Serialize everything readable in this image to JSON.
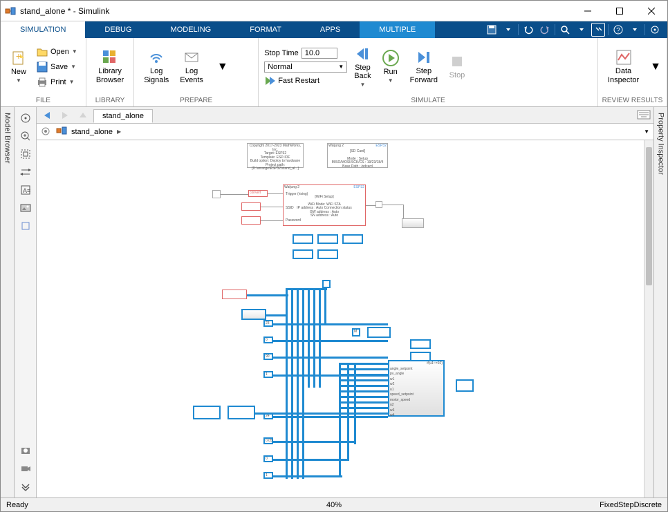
{
  "title": "stand_alone * - Simulink",
  "tabs": [
    "SIMULATION",
    "DEBUG",
    "MODELING",
    "FORMAT",
    "APPS",
    "MULTIPLE"
  ],
  "ribbon": {
    "file": {
      "new": "New",
      "open": "Open",
      "save": "Save",
      "print": "Print",
      "group": "FILE"
    },
    "library": {
      "browser": "Library\nBrowser",
      "group": "LIBRARY"
    },
    "prepare": {
      "log_signals": "Log\nSignals",
      "log_events": "Log\nEvents",
      "group": "PREPARE"
    },
    "simulate": {
      "stop_time_label": "Stop Time",
      "stop_time_value": "10.0",
      "mode": "Normal",
      "fast_restart": "Fast Restart",
      "step_back": "Step\nBack",
      "run": "Run",
      "step_forward": "Step\nForward",
      "stop": "Stop",
      "group": "SIMULATE"
    },
    "review": {
      "data_inspector": "Data\nInspector",
      "group": "REVIEW RESULTS"
    }
  },
  "side_tabs": {
    "left": "Model Browser",
    "right": "Property Inspector"
  },
  "explorer": {
    "doc_tab": "stand_alone"
  },
  "breadcrumb": {
    "root": "stand_alone"
  },
  "status": {
    "ready": "Ready",
    "zoom": "40%",
    "solver": "FixedStepDiscrete"
  },
  "canvas": {
    "info_block1": "Copyright 2017-2023 MathWorks, Inc.\nTarget: ESP32\nTemplate: ESP-IDF\nBuild option: Deploy to hardware\nProject path:\n[D:\\arrange\\ESP32\\stand_al...]",
    "info_block2_title": "Waijung 2",
    "info_block2_tag": "ESP32",
    "info_block2_body": "[SD Card]\n\nMode : Setup\nMISO/MOSI/SCK/CS : 19/23/18/4\nBase Path : /sdcard",
    "wifi_title": "Waijung 2",
    "wifi_tag": "ESP32",
    "wifi_body": "[WiFi Setup]\n\nWiFi Mode: WiFi STA\nIP address : Auto     Connection status\nGW address : Auto\nSN address : Auto",
    "wifi_pins": {
      "trigger": "Trigger (rising)",
      "ssid": "SSID",
      "password": "Password"
    },
    "convert": "convert",
    "m_label": "M",
    "scope_pins": [
      "angle_setpoint",
      "pv_angle",
      "w1",
      "w2",
      "u1",
      "speed_setpoint",
      "motor_speed",
      "u2",
      "w3",
      "w4"
    ],
    "scope_label": "if(u1~=10)",
    "const_blocks": [
      "23",
      "0",
      "90",
      "1",
      "24",
      "0.05",
      "0",
      "1"
    ]
  }
}
